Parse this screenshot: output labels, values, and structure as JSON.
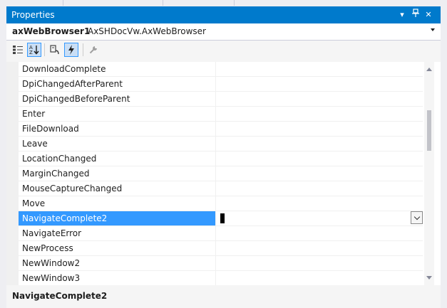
{
  "panel": {
    "title": "Properties",
    "title_buttons": {
      "dropdown_glyph": "▾",
      "pin_glyph": "⊥",
      "close_glyph": "✕"
    }
  },
  "object_selector": {
    "name": "axWebBrowser1",
    "type": "AxSHDocVw.AxWebBrowser"
  },
  "toolbar": {
    "categorized_icon": "categorized-icon",
    "alphabetical_icon": "alphabetical-icon",
    "properties_icon": "properties-icon",
    "events_icon": "events-icon",
    "property_pages_icon": "wrench-icon"
  },
  "grid": {
    "rows": [
      {
        "name": "DownloadComplete",
        "value": ""
      },
      {
        "name": "DpiChangedAfterParent",
        "value": ""
      },
      {
        "name": "DpiChangedBeforeParent",
        "value": ""
      },
      {
        "name": "Enter",
        "value": ""
      },
      {
        "name": "FileDownload",
        "value": ""
      },
      {
        "name": "Leave",
        "value": ""
      },
      {
        "name": "LocationChanged",
        "value": ""
      },
      {
        "name": "MarginChanged",
        "value": ""
      },
      {
        "name": "MouseCaptureChanged",
        "value": ""
      },
      {
        "name": "Move",
        "value": ""
      },
      {
        "name": "NavigateComplete2",
        "value": ""
      },
      {
        "name": "NavigateError",
        "value": ""
      },
      {
        "name": "NewProcess",
        "value": ""
      },
      {
        "name": "NewWindow2",
        "value": ""
      },
      {
        "name": "NewWindow3",
        "value": ""
      }
    ],
    "selected_row": "NavigateComplete2"
  },
  "description": {
    "name": "NavigateComplete2"
  },
  "colors": {
    "titlebar": "#007acc",
    "selection": "#3399ff",
    "background": "#f5f5f5"
  }
}
